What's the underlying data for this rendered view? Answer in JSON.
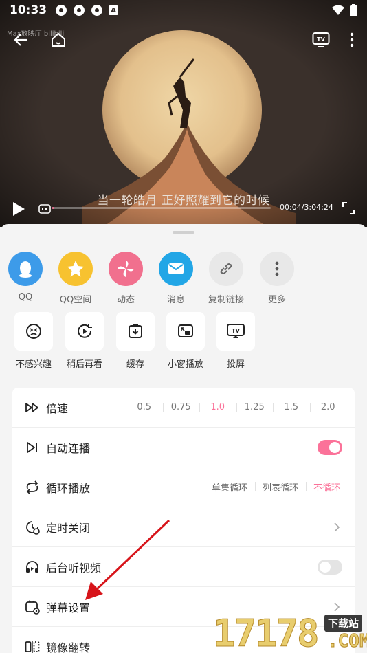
{
  "status_bar": {
    "time": "10:33",
    "notif_badge": "A"
  },
  "video": {
    "brand_watermark": "Max放映厅 bilibili",
    "subtitle": "当一轮皓月 正好照耀到它的时候",
    "time_current": "00:04",
    "time_total": "3:04:24",
    "time_display": "00:04/3:04:24",
    "progress_fraction": 0.0004
  },
  "share": {
    "items": [
      {
        "label": "QQ",
        "icon": "qq-icon",
        "color": "#3d9be9"
      },
      {
        "label": "QQ空间",
        "icon": "qzone-star-icon",
        "color": "#f7c230"
      },
      {
        "label": "动态",
        "icon": "pinwheel-icon",
        "color": "#f1708e"
      },
      {
        "label": "消息",
        "icon": "envelope-icon",
        "color": "#22a6e6"
      },
      {
        "label": "复制链接",
        "icon": "link-icon",
        "color": "#e8e8e8"
      },
      {
        "label": "更多",
        "icon": "more-dots-icon",
        "color": "#e8e8e8"
      }
    ]
  },
  "actions": {
    "items": [
      {
        "label": "不感兴趣",
        "icon": "dislike-face-icon"
      },
      {
        "label": "稍后再看",
        "icon": "watch-later-icon"
      },
      {
        "label": "缓存",
        "icon": "download-cache-icon"
      },
      {
        "label": "小窗播放",
        "icon": "pip-window-icon"
      },
      {
        "label": "投屏",
        "icon": "cast-tv-icon"
      }
    ]
  },
  "settings": {
    "speed": {
      "label": "倍速",
      "options": [
        "0.5",
        "0.75",
        "1.0",
        "1.25",
        "1.5",
        "2.0"
      ],
      "selected": "1.0"
    },
    "autoplay": {
      "label": "自动连播",
      "enabled": true
    },
    "loop": {
      "label": "循环播放",
      "options": [
        "单集循环",
        "列表循环",
        "不循环"
      ],
      "selected": "不循环"
    },
    "timer": {
      "label": "定时关闭"
    },
    "background_play": {
      "label": "后台听视频",
      "enabled": false
    },
    "danmaku": {
      "label": "弹幕设置"
    },
    "mirror": {
      "label": "镜像翻转"
    }
  },
  "colors": {
    "accent": "#fb7299",
    "toggle_off": "#e4e4e4"
  },
  "site_watermark": {
    "digits": "17178",
    "badge": "下载站",
    "suffix": ".COM"
  }
}
